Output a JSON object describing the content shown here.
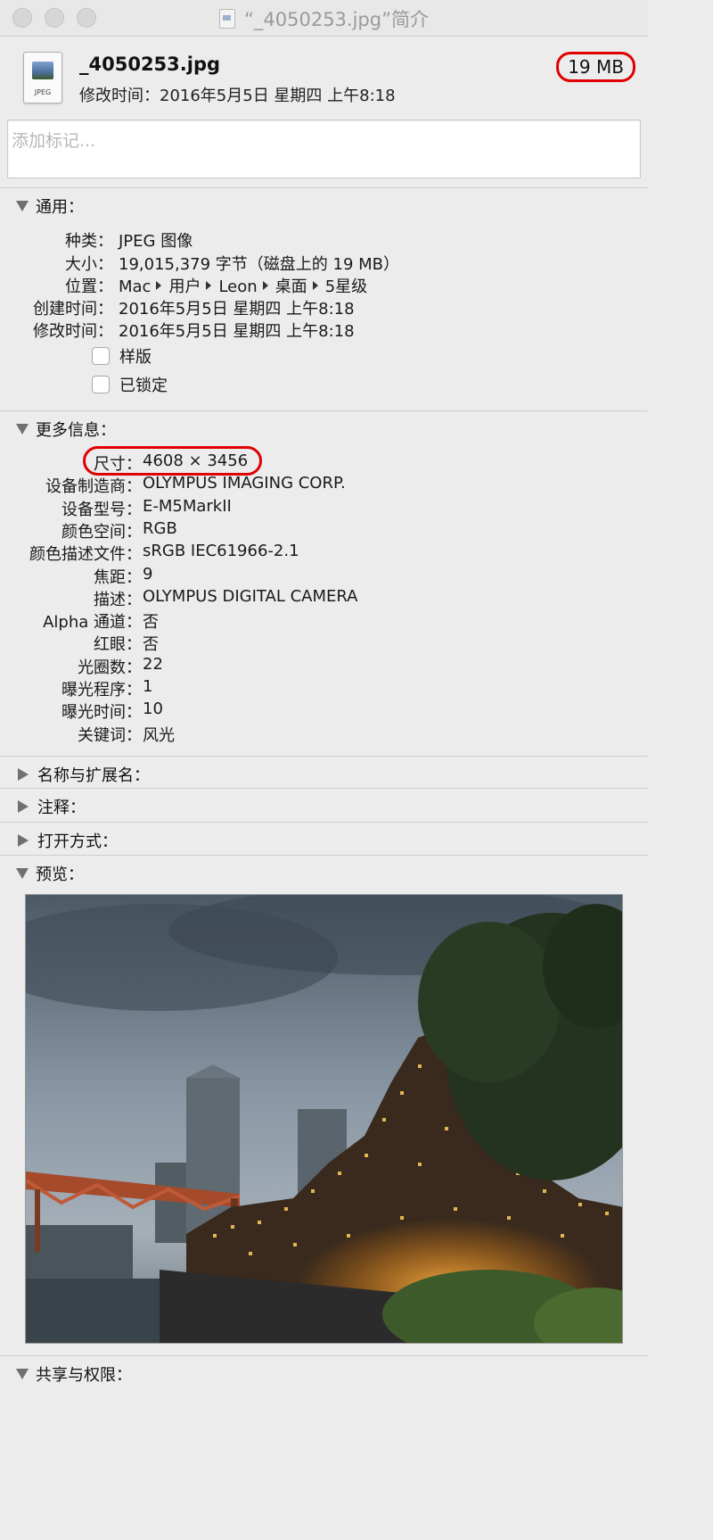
{
  "window": {
    "title": "“_4050253.jpg”简介"
  },
  "header": {
    "file_icon_label": "JPEG",
    "file_name": "_4050253.jpg",
    "modified": "修改时间：2016年5月5日 星期四 上午8:18",
    "size": "19 MB"
  },
  "tags": {
    "placeholder": "添加标记..."
  },
  "general": {
    "title": "通用：",
    "rows": [
      {
        "key": "种类：",
        "value": "JPEG 图像"
      },
      {
        "key": "大小：",
        "value": "19,015,379 字节（磁盘上的 19 MB）"
      },
      {
        "key": "位置：",
        "path": [
          "Mac",
          "用户",
          "Leon",
          "桌面",
          "5星级"
        ]
      },
      {
        "key": "创建时间：",
        "value": "2016年5月5日 星期四 上午8:18"
      },
      {
        "key": "修改时间：",
        "value": "2016年5月5日 星期四 上午8:18"
      }
    ],
    "checkboxes": [
      {
        "label": "样版",
        "checked": false
      },
      {
        "label": "已锁定",
        "checked": false
      }
    ]
  },
  "more_info": {
    "title": "更多信息：",
    "rows": [
      {
        "key": "尺寸：",
        "value": "4608 × 3456"
      },
      {
        "key": "设备制造商：",
        "value": "OLYMPUS IMAGING CORP."
      },
      {
        "key": "设备型号：",
        "value": "E-M5MarkII"
      },
      {
        "key": "颜色空间：",
        "value": "RGB"
      },
      {
        "key": "颜色描述文件：",
        "value": "sRGB IEC61966-2.1"
      },
      {
        "key": "焦距：",
        "value": "9"
      },
      {
        "key": "描述：",
        "value": "OLYMPUS DIGITAL CAMERA"
      },
      {
        "key": "Alpha 通道：",
        "value": "否"
      },
      {
        "key": "红眼：",
        "value": "否"
      },
      {
        "key": "光圈数：",
        "value": "22"
      },
      {
        "key": "曝光程序：",
        "value": "1"
      },
      {
        "key": "曝光时间：",
        "value": "10"
      },
      {
        "key": "关键词：",
        "value": "风光"
      }
    ]
  },
  "collapsed_sections": [
    {
      "title": "名称与扩展名："
    },
    {
      "title": "注释："
    },
    {
      "title": "打开方式："
    }
  ],
  "preview": {
    "title": "预览："
  },
  "sharing": {
    "title": "共享与权限："
  },
  "colors": {
    "highlight": "#e00000",
    "background": "#ececec"
  }
}
